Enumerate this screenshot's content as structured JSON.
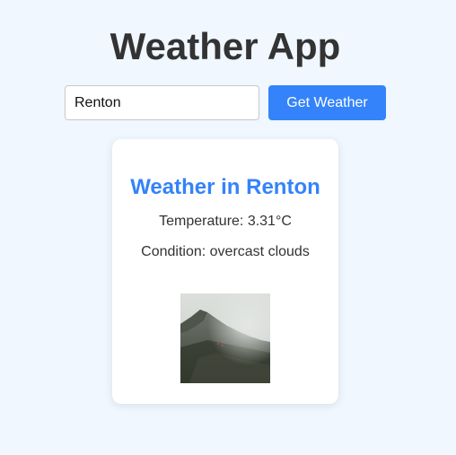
{
  "app": {
    "title": "Weather App"
  },
  "search": {
    "value": "Renton",
    "button_label": "Get Weather"
  },
  "weather": {
    "heading_prefix": "Weather in",
    "city": "Renton",
    "temperature_label": "Temperature:",
    "temperature_value": "3.31°C",
    "condition_label": "Condition:",
    "condition_value": "overcast clouds",
    "image_icon": "overcast-mountain-photo"
  },
  "colors": {
    "background": "#f0f7ff",
    "accent": "#3483fa",
    "text": "#333333",
    "card": "#ffffff"
  }
}
